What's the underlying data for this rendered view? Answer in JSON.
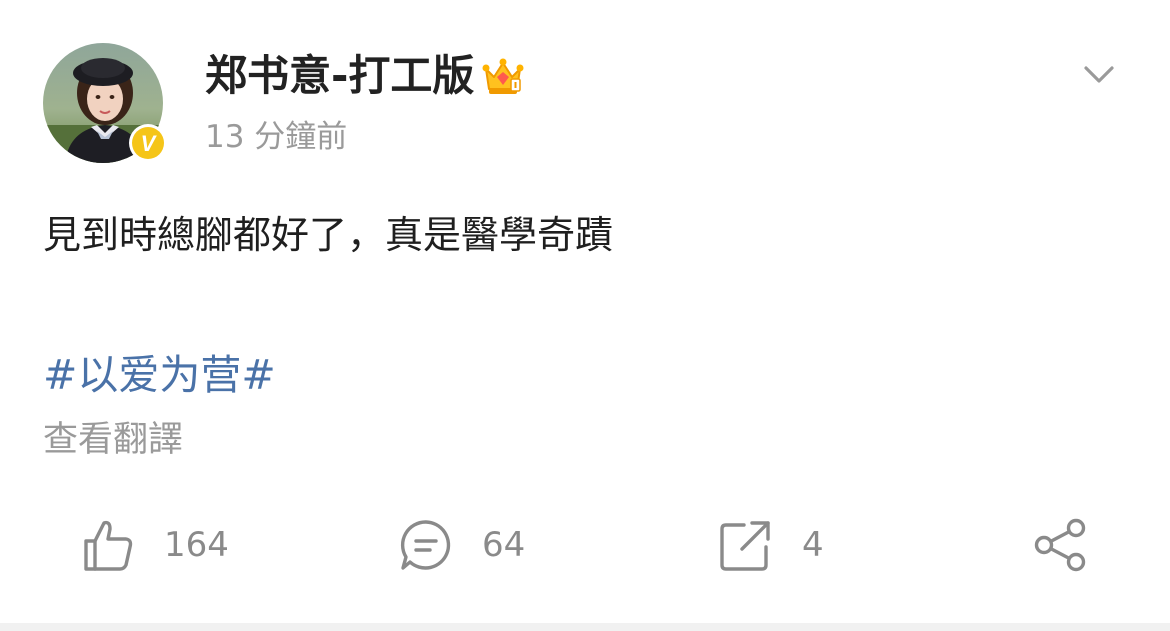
{
  "post": {
    "author": {
      "name": "郑书意-打工版",
      "avatar_icon": "avatar-photo",
      "verified_icon": "verified-v-badge",
      "member_icon": "crown-icon",
      "verified_color": "#f5c518"
    },
    "timestamp": "13 分鐘前",
    "text": "見到時總腳都好了，真是醫學奇蹟",
    "hashtag": "#以爱为营#",
    "translate_label": "查看翻譯",
    "menu_icon": "chevron-down-icon"
  },
  "actions": {
    "like": {
      "icon": "thumbs-up-icon",
      "count": "164"
    },
    "comment": {
      "icon": "comment-icon",
      "count": "64"
    },
    "repost": {
      "icon": "repost-icon",
      "count": "4"
    },
    "share": {
      "icon": "share-icon"
    }
  },
  "colors": {
    "hashtag": "#4a72a8",
    "secondary_text": "#9a9a9a",
    "icon": "#8a8a8a"
  }
}
